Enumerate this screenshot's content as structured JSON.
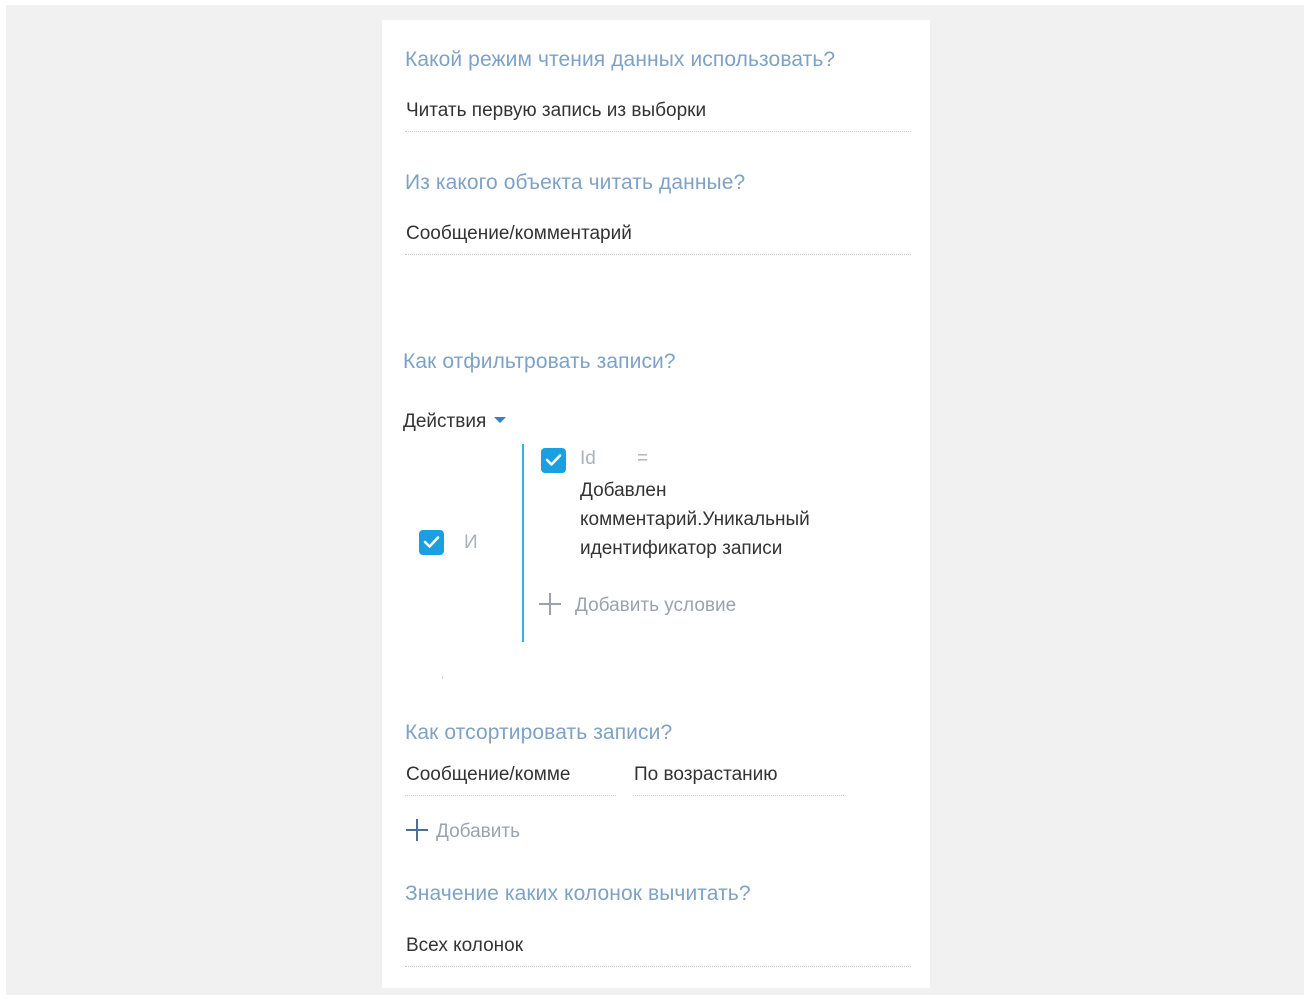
{
  "read_mode": {
    "question": "Какой режим чтения данных использовать?",
    "value": "Читать первую запись из выборки"
  },
  "source_object": {
    "question": "Из какого объекта читать данные?",
    "value": "Сообщение/комментарий"
  },
  "filter": {
    "question": "Как отфильтровать записи?",
    "actions_label": "Действия",
    "group_operator": "И",
    "group_checked": true,
    "conditions": [
      {
        "checked": true,
        "column": "Id",
        "operator": "=",
        "value": "Добавлен комментарий.Уникальный идентификатор записи"
      }
    ],
    "add_condition_label": "Добавить условие"
  },
  "sort": {
    "question": "Как отсортировать записи?",
    "column_value": "Сообщение/комме",
    "direction_value": "По возрастанию",
    "add_label": "Добавить"
  },
  "columns": {
    "question": "Значение каких колонок вычитать?",
    "value": "Всех колонок"
  },
  "colors": {
    "accent": "#1aa0e0",
    "question_text": "#7ea2c6",
    "group_line": "#35aee0"
  }
}
